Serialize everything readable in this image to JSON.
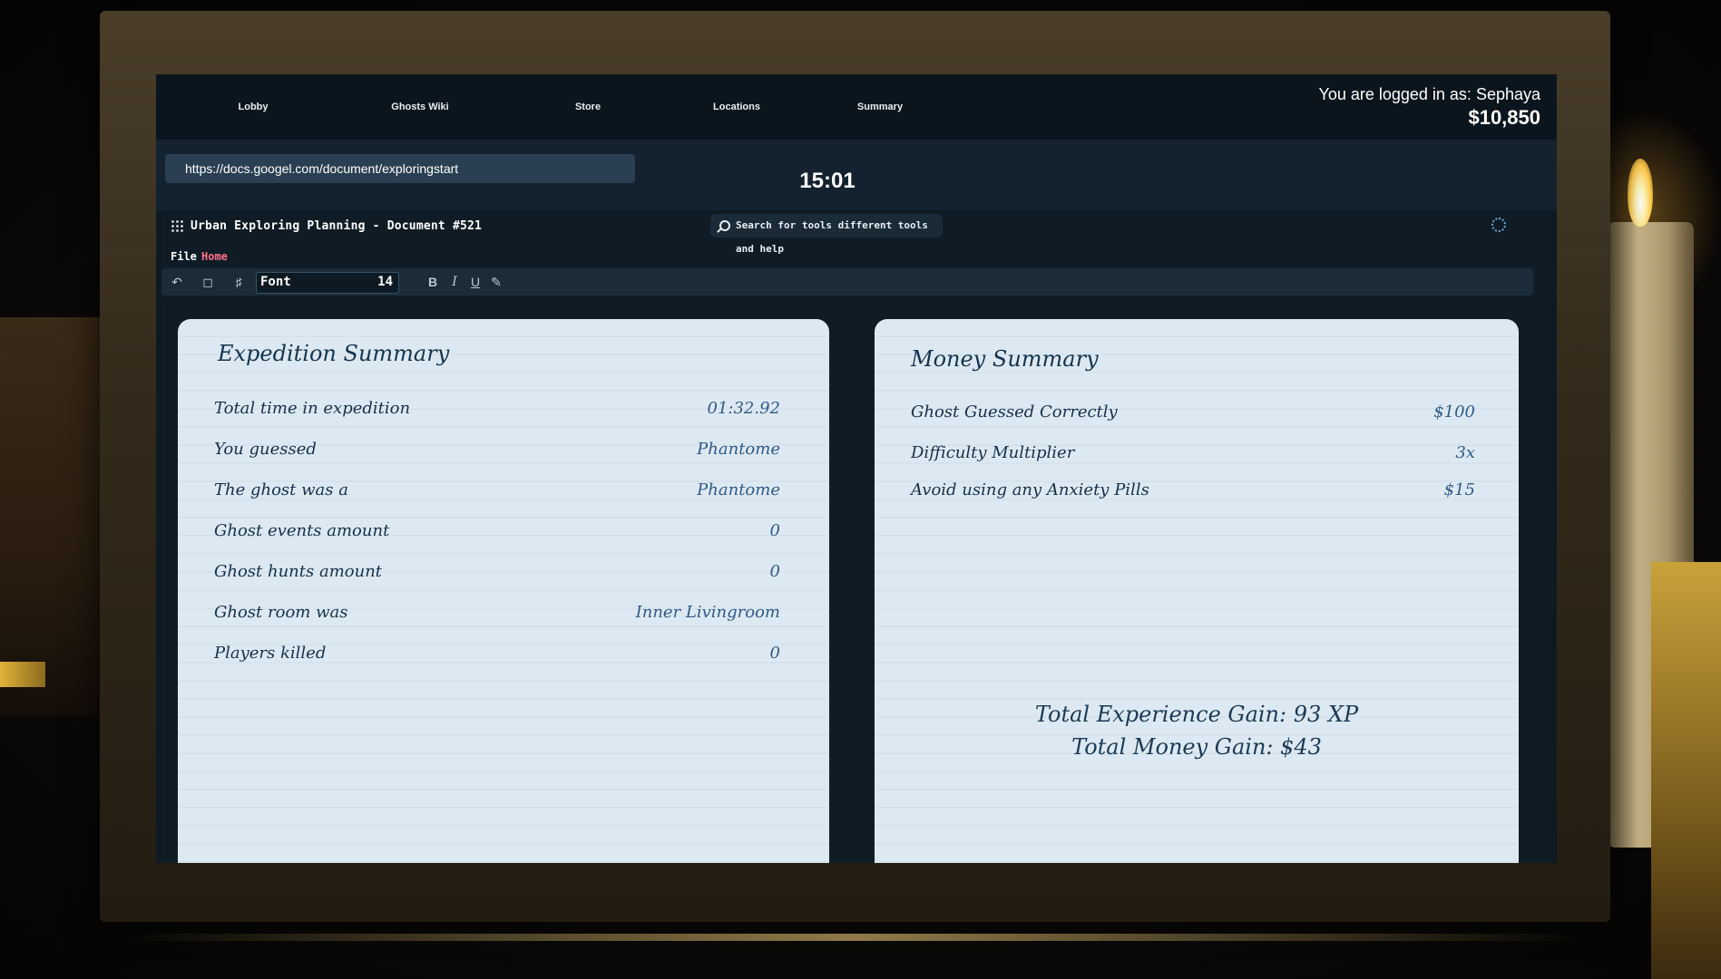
{
  "nav": {
    "items": [
      "Lobby",
      "Ghosts Wiki",
      "Store",
      "Locations",
      "Summary"
    ],
    "user_line": "You are logged in as: Sephaya",
    "balance": "$10,850"
  },
  "address": {
    "url": "https://docs.googel.com/document/exploringstart",
    "clock": "15:01"
  },
  "doc": {
    "title": "Urban Exploring Planning - Document #521",
    "search_placeholder": "Search for tools different tools and help",
    "menu": {
      "file": "File",
      "home": "Home"
    },
    "toolbar": {
      "font_name": "Font",
      "font_size": "14",
      "bold": "B",
      "italic": "I",
      "underline": "U"
    }
  },
  "expedition": {
    "title": "Expedition Summary",
    "rows": [
      {
        "label": "Total time in expedition",
        "value": "01:32.92"
      },
      {
        "label": "You guessed",
        "value": "Phantome"
      },
      {
        "label": "The ghost was a",
        "value": "Phantome"
      },
      {
        "label": "Ghost events amount",
        "value": "0"
      },
      {
        "label": "Ghost hunts amount",
        "value": "0"
      },
      {
        "label": "Ghost room was",
        "value": "Inner Livingroom"
      },
      {
        "label": "Players killed",
        "value": "0"
      }
    ]
  },
  "money": {
    "title": "Money Summary",
    "rows": [
      {
        "label": "Ghost Guessed Correctly",
        "value": "$100"
      },
      {
        "label": "Difficulty Multiplier",
        "value": "3x"
      },
      {
        "label": "Avoid using any Anxiety Pills",
        "value": "$15"
      }
    ],
    "total_xp": "Total Experience Gain: 93 XP",
    "total_money": "Total Money Gain: $43"
  },
  "colors": {
    "accent_home": "#ff6f8a",
    "screen_bg": "#0e1a23",
    "paper_bg": "#dde9f2"
  }
}
